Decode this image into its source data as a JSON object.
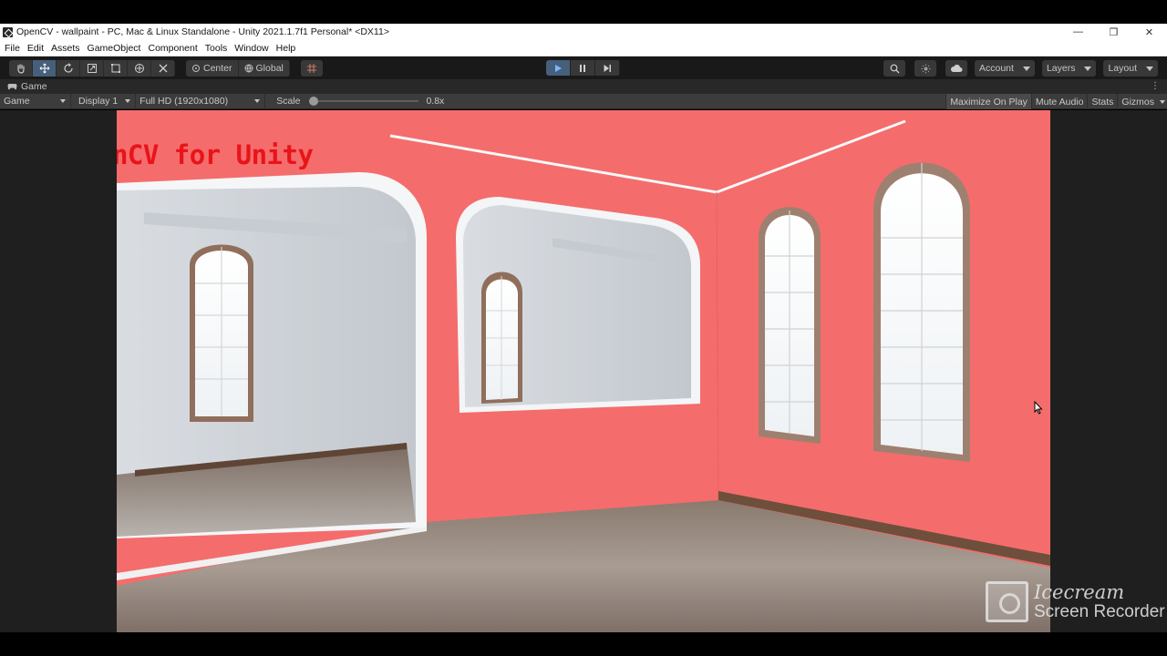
{
  "window": {
    "title": "OpenCV - wallpaint - PC, Mac & Linux Standalone - Unity 2021.1.7f1 Personal* <DX11>",
    "controls": [
      "—",
      "❐",
      "✕"
    ]
  },
  "menu": [
    "File",
    "Edit",
    "Assets",
    "GameObject",
    "Component",
    "Tools",
    "Window",
    "Help"
  ],
  "toolbar": {
    "tools": [
      "hand-tool",
      "move-tool",
      "rotate-tool",
      "scale-tool",
      "rect-tool",
      "transform-tool",
      "custom-tool"
    ],
    "pivot_label": "Center",
    "space_label": "Global",
    "account_label": "Account",
    "layers_label": "Layers",
    "layout_label": "Layout"
  },
  "tab": {
    "label": "Game"
  },
  "gamebar": {
    "view_mode": "Game",
    "display": "Display 1",
    "resolution": "Full HD (1920x1080)",
    "scale_label": "Scale",
    "scale_value": "0.8x",
    "scale_fraction": 0.0,
    "maximize": "Maximize On Play",
    "mute": "Mute Audio",
    "stats": "Stats",
    "gizmos": "Gizmos"
  },
  "game": {
    "overlay_text": "enCV for Unity",
    "wall_color": "#f56c6c",
    "overlay_color": "#e8141a"
  },
  "watermark": {
    "brand": "Icecream",
    "product": "Screen Recorder"
  }
}
